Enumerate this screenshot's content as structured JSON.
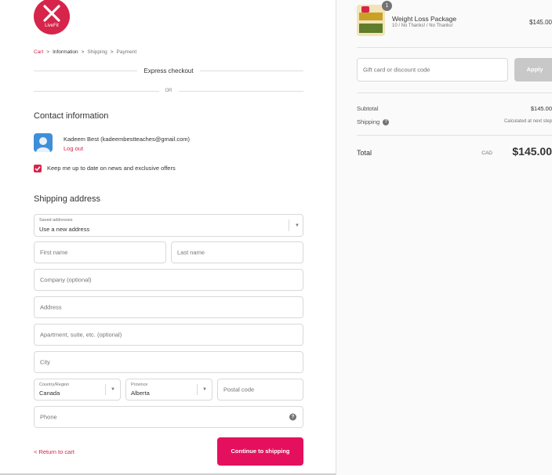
{
  "brand": {
    "logo_text": "LiveFit",
    "accent": "#d6244b",
    "button": "#e5105d"
  },
  "breadcrumb": {
    "items": [
      "Cart",
      "Information",
      "Shipping",
      "Payment"
    ],
    "separator": ">"
  },
  "express": {
    "label": "Express checkout",
    "or": "OR"
  },
  "contact": {
    "title": "Contact information",
    "user": "Kadeem Best (kadeembestteaches@gmail.com)",
    "logout": "Log out",
    "newsletter": "Keep me up to date on news and exclusive offers",
    "newsletter_checked": true
  },
  "shipping": {
    "title": "Shipping address",
    "saved_label": "Saved addresses",
    "saved_value": "Use a new address",
    "first_name": "First name",
    "last_name": "Last name",
    "company": "Company (optional)",
    "address": "Address",
    "apartment": "Apartment, suite, etc. (optional)",
    "city": "City",
    "country_label": "Country/Region",
    "country_value": "Canada",
    "province_label": "Province",
    "province_value": "Alberta",
    "postal": "Postal code",
    "phone": "Phone"
  },
  "footer": {
    "return": "< Return to cart",
    "continue": "Continue to shipping"
  },
  "order": {
    "product_name": "Weight Loss Package",
    "product_variant": "10 / No Thanks! / No Thanks!",
    "product_price": "$145.00",
    "quantity": "1",
    "gift_placeholder": "Gift card or discount code",
    "apply": "Apply",
    "subtotal_label": "Subtotal",
    "subtotal_value": "$145.00",
    "shipping_label": "Shipping",
    "shipping_value": "Calculated at next step",
    "total_label": "Total",
    "currency": "CAD",
    "total_value": "$145.00"
  }
}
